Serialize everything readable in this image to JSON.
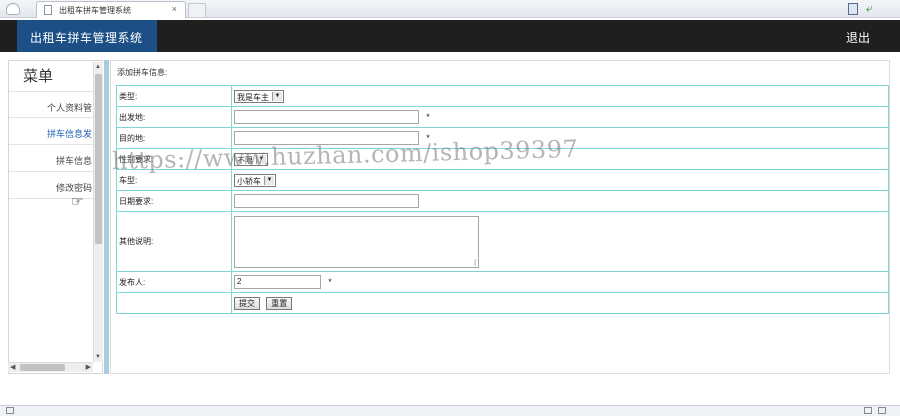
{
  "browser": {
    "tab_title": "出租车拼车管理系统",
    "tab_close": "×"
  },
  "header": {
    "app_title": "出租车拼车管理系统",
    "logout_label": "退出"
  },
  "sidebar": {
    "title": "菜单",
    "items": [
      {
        "label": "个人资料管"
      },
      {
        "label": "拼车信息发"
      },
      {
        "label": "拼车信息"
      },
      {
        "label": "修改密码"
      }
    ]
  },
  "form": {
    "caption": "添加拼车信息:",
    "fields": {
      "type": {
        "label": "类型:",
        "value": "我是车主"
      },
      "departure": {
        "label": "出发地:",
        "value": "",
        "required": "*"
      },
      "destination": {
        "label": "目的地:",
        "value": "",
        "required": "*"
      },
      "gender": {
        "label": "性别要求:",
        "value": "不限"
      },
      "car_type": {
        "label": "车型:",
        "value": "小轿车"
      },
      "date": {
        "label": "日期要求:",
        "value": ""
      },
      "notes": {
        "label": "其他说明:",
        "value": ""
      },
      "publisher": {
        "label": "发布人:",
        "value": "2",
        "required": "*"
      }
    },
    "submit_label": "提交",
    "reset_label": "重置"
  },
  "watermark": "https://www.huzhan.com/ishop39397",
  "colors": {
    "header_bg": "#1f1f1f",
    "title_block_bg": "#1c4f86",
    "table_border": "#7fd6d6",
    "splitter": "#a9cde0",
    "active_menu": "#1d5fb3"
  }
}
